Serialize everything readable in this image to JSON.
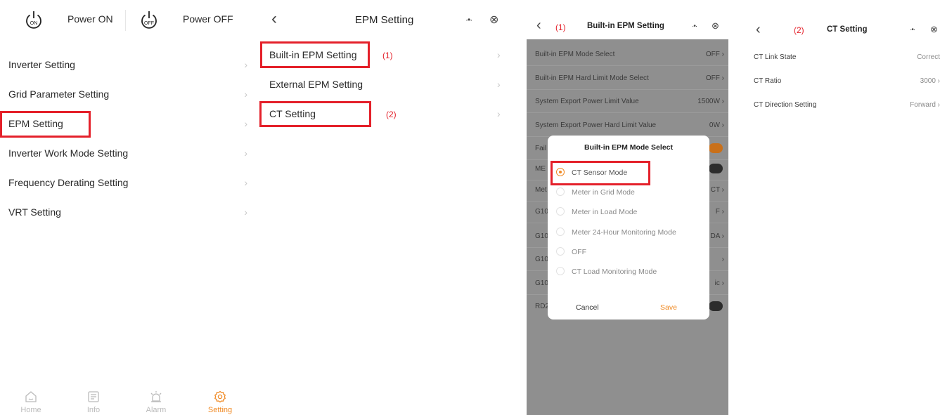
{
  "panel1": {
    "power_on_icon": "ON",
    "power_on_label": "Power ON",
    "power_off_icon": "OFF",
    "power_off_label": "Power OFF",
    "menu": [
      {
        "label": "Inverter Setting"
      },
      {
        "label": "Grid Parameter Setting"
      },
      {
        "label": "EPM Setting"
      },
      {
        "label": "Inverter Work Mode Setting"
      },
      {
        "label": "Frequency Derating Setting"
      },
      {
        "label": "VRT Setting"
      }
    ],
    "tabs": [
      {
        "label": "Home",
        "icon": "home-icon"
      },
      {
        "label": "Info",
        "icon": "info-icon"
      },
      {
        "label": "Alarm",
        "icon": "alarm-icon"
      },
      {
        "label": "Setting",
        "icon": "setting-icon"
      }
    ],
    "active_color": "#f08a24"
  },
  "panel2": {
    "title": "EPM Setting",
    "more_icon": "·•·",
    "close_icon": "⊗",
    "items": [
      {
        "label": "Built-in EPM Setting",
        "note": "(1)"
      },
      {
        "label": "External EPM Setting"
      },
      {
        "label": "CT Setting",
        "note": "(2)"
      }
    ]
  },
  "panel3": {
    "step": "(1)",
    "title": "Built-in EPM Setting",
    "rows": [
      {
        "label": "Built-in EPM Mode Select",
        "value": "OFF"
      },
      {
        "label": "Built-in EPM Hard Limit Mode Select",
        "value": "OFF"
      },
      {
        "label": "System Export Power Limit Value",
        "value": "1500W"
      },
      {
        "label": "System Export Power Hard Limit Value",
        "value": "0W"
      },
      {
        "label": "Fail"
      },
      {
        "label": "ME"
      },
      {
        "label": "Met",
        "value": "CT"
      },
      {
        "label": "G10",
        "value": "F"
      },
      {
        "label": "G10",
        "value": "DA"
      },
      {
        "label": "G10",
        "value": ""
      },
      {
        "label": "G10",
        "value": "ic"
      },
      {
        "label": "RD2"
      }
    ],
    "dialog": {
      "title": "Built-in EPM Mode Select",
      "options": [
        "CT Sensor Mode",
        "Meter in Grid Mode",
        "Meter in Load Mode",
        "Meter 24-Hour Monitoring Mode",
        "OFF",
        "CT Load Monitoring Mode"
      ],
      "selected_index": 0,
      "cancel": "Cancel",
      "save": "Save"
    }
  },
  "panel4": {
    "step": "(2)",
    "title": "CT Setting",
    "rows": [
      {
        "label": "CT Link State",
        "value": "Correct"
      },
      {
        "label": "CT Ratio",
        "value": "3000"
      },
      {
        "label": "CT Direction Setting",
        "value": "Forward"
      }
    ]
  },
  "colors": {
    "highlight": "#e4202a",
    "accent": "#f08a24",
    "overlay": "#8f8f8f"
  }
}
